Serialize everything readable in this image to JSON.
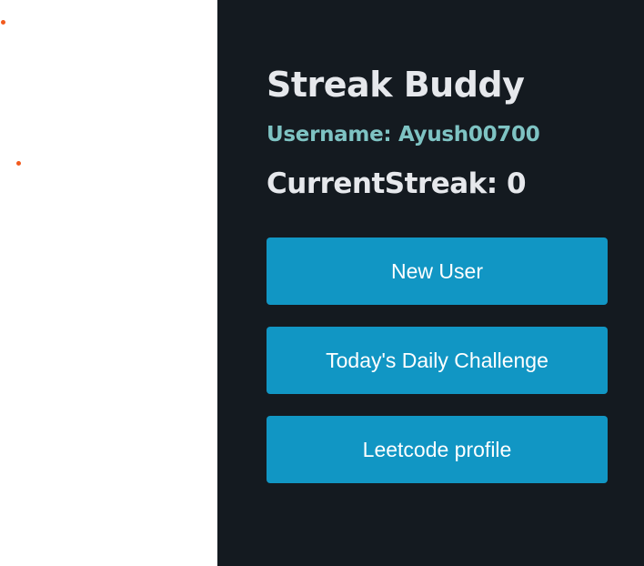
{
  "colors": {
    "panel_bg": "#141a20",
    "page_bg": "#ffffff",
    "title_text": "#e6e8ec",
    "username_text": "#7ec3c3",
    "button_bg": "#1196c4",
    "button_text": "#ffffff",
    "accent_dot": "#f25a1d"
  },
  "app": {
    "title": "Streak Buddy"
  },
  "user": {
    "username_line": "Username: Ayush00700",
    "streak_line": "CurrentStreak: 0"
  },
  "buttons": {
    "new_user": "New User",
    "daily_challenge": "Today's Daily Challenge",
    "leetcode_profile": "Leetcode profile"
  }
}
